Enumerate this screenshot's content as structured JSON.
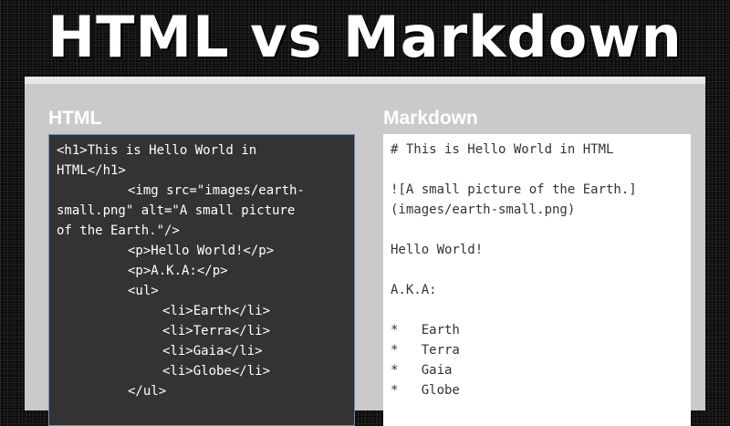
{
  "banner": {
    "title": "HTML vs Markdown"
  },
  "html_panel": {
    "heading": "HTML",
    "lines": [
      "<h1>This is Hello World in",
      "HTML</h1>",
      "<img src=\"images/earth-",
      "small.png\" alt=\"A small picture",
      "of the Earth.\"/>",
      "<p>Hello World!</p>",
      "<p>A.K.A:</p>",
      "<ul>",
      "<li>Earth</li>",
      "<li>Terra</li>",
      "<li>Gaia</li>",
      "<li>Globe</li>",
      "</ul>"
    ]
  },
  "markdown_panel": {
    "heading": "Markdown",
    "lines": [
      "# This is Hello World in HTML",
      "",
      "![A small picture of the Earth.]",
      "(images/earth-small.png)",
      "",
      "Hello World!",
      "",
      "A.K.A:",
      "",
      "*   Earth",
      "*   Terra",
      "*   Gaia",
      "*   Globe"
    ]
  },
  "colors": {
    "html_code_bg": "#333333",
    "markdown_code_bg": "#ffffff",
    "panel_bg": "#cacaca"
  }
}
